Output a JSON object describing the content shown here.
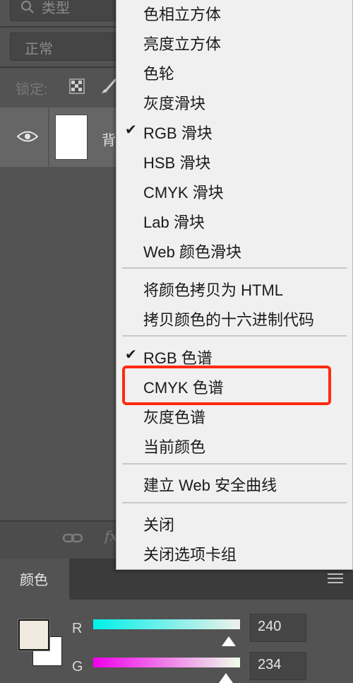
{
  "layers_panel": {
    "filter_label": "类型",
    "blend_mode": "正常",
    "lock_label": "锁定:",
    "layer_name": "背",
    "fx_label": "fx"
  },
  "menu": {
    "items": [
      {
        "label": "色相立方体",
        "checked": false
      },
      {
        "label": "亮度立方体",
        "checked": false
      },
      {
        "label": "色轮",
        "checked": false
      },
      {
        "label": "灰度滑块",
        "checked": false
      },
      {
        "label": "RGB 滑块",
        "checked": true
      },
      {
        "label": "HSB 滑块",
        "checked": false
      },
      {
        "label": "CMYK 滑块",
        "checked": false
      },
      {
        "label": "Lab 滑块",
        "checked": false
      },
      {
        "label": "Web 颜色滑块",
        "checked": false
      },
      {
        "label": "将颜色拷贝为 HTML",
        "checked": false
      },
      {
        "label": "拷贝颜色的十六进制代码",
        "checked": false
      },
      {
        "label": "RGB 色谱",
        "checked": true
      },
      {
        "label": "CMYK 色谱",
        "checked": false,
        "highlighted": true
      },
      {
        "label": "灰度色谱",
        "checked": false
      },
      {
        "label": "当前颜色",
        "checked": false
      },
      {
        "label": "建立 Web 安全曲线",
        "checked": false
      },
      {
        "label": "关闭",
        "checked": false
      },
      {
        "label": "关闭选项卡组",
        "checked": false
      }
    ],
    "check_glyph": "✔"
  },
  "color_panel": {
    "tab_label": "颜色",
    "foreground_color": "#f0eadf",
    "background_color": "#ffffff",
    "channels": [
      {
        "label": "R",
        "value": "240"
      },
      {
        "label": "G",
        "value": "234"
      }
    ]
  },
  "colors": {
    "highlight_border": "#ff2a10",
    "menu_bg": "#f0f0f0",
    "panel_bg": "#535353"
  }
}
